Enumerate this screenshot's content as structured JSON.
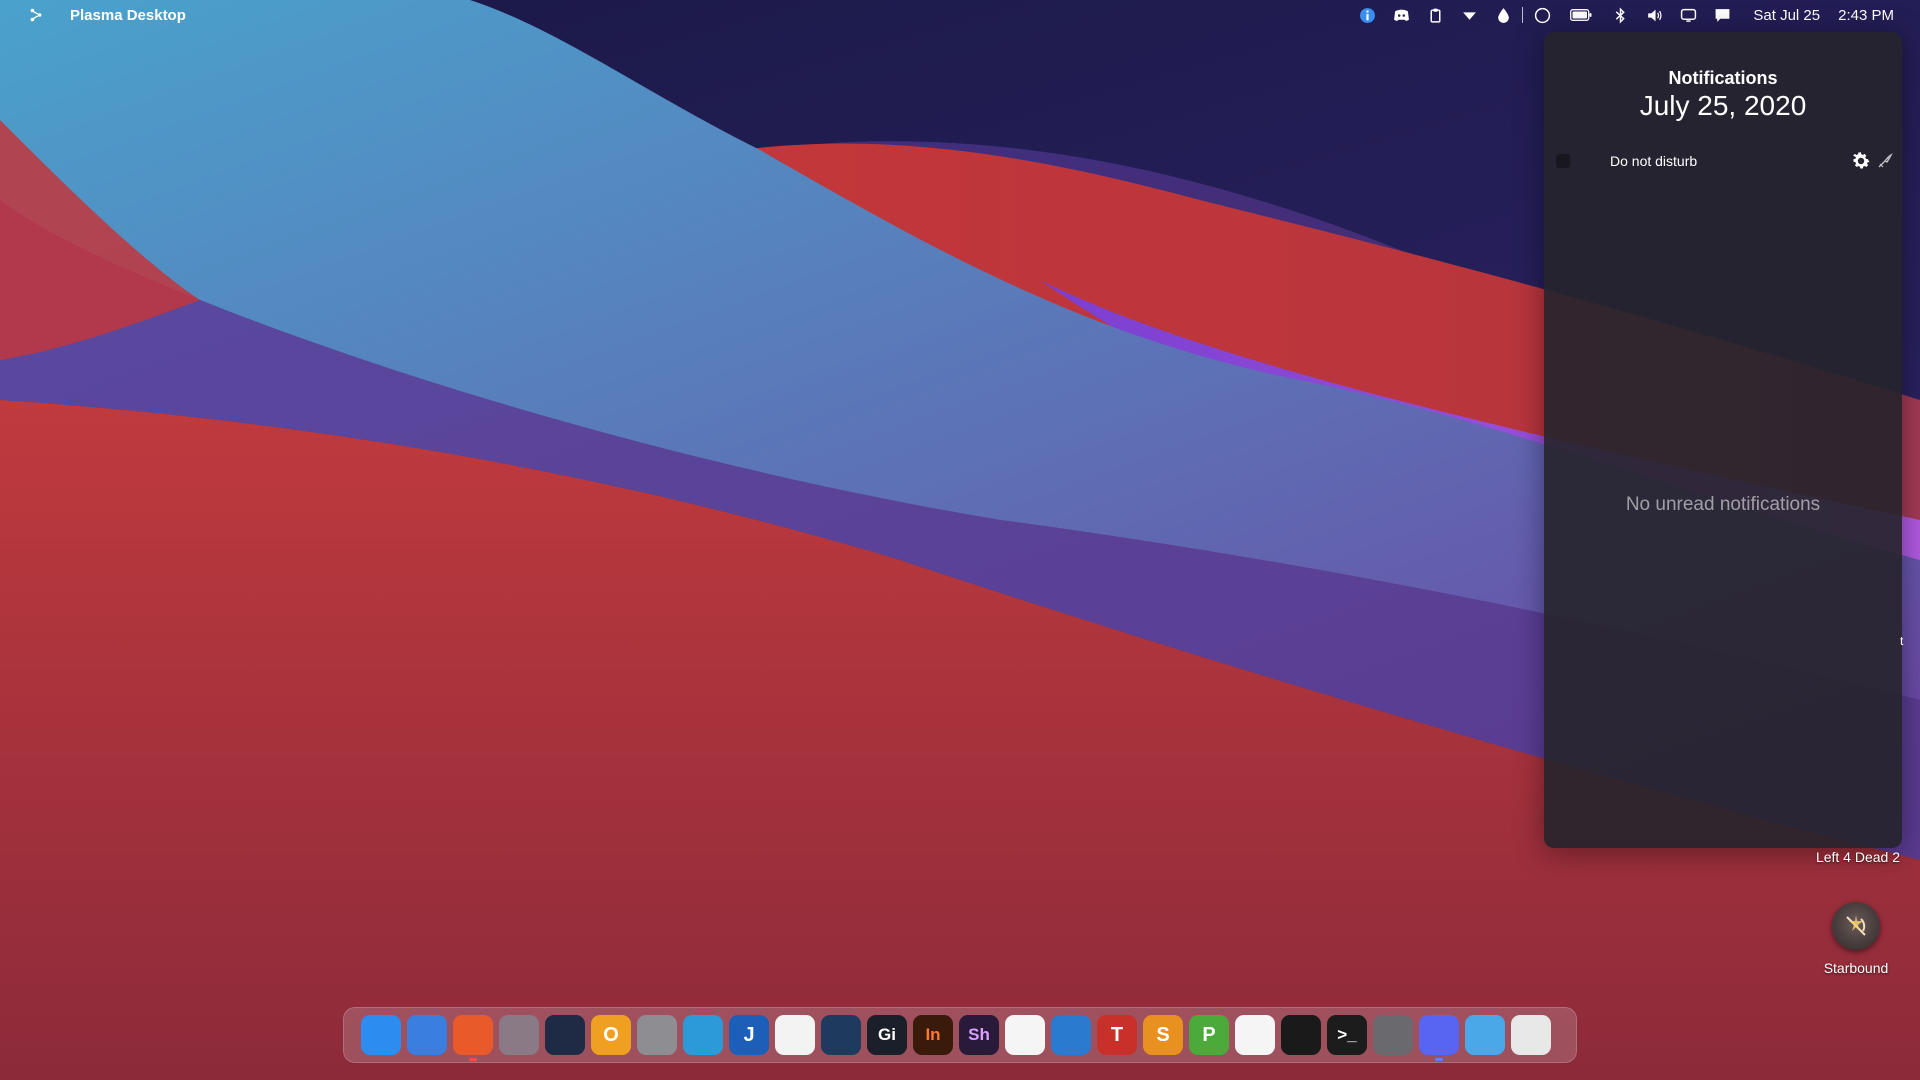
{
  "wallpaper": {
    "colors": {
      "navy": "#1f1b4d",
      "teal": "#5aa6c9",
      "violet": "#5a4ba0",
      "red": "#b8373a",
      "magenta": "#a64fd6"
    }
  },
  "menubar": {
    "app_title": "Plasma Desktop",
    "date": "Sat Jul 25",
    "time": "2:43 PM",
    "tray_icons": [
      "info-icon",
      "discord-tray-icon",
      "clipboard-icon",
      "dropdown-arrow-icon",
      "drop-icon",
      "circle-icon",
      "battery-icon",
      "bluetooth-icon",
      "volume-icon",
      "display-icon",
      "notifications-icon"
    ]
  },
  "notifications": {
    "title": "Notifications",
    "date": "July 25, 2020",
    "dnd_label": "Do not disturb",
    "empty_text": "No unread notifications"
  },
  "desktop": {
    "l4d2_label": "Left 4 Dead 2",
    "starbound_label": "Starbound",
    "edge_text": "t"
  },
  "dock": {
    "items": [
      {
        "name": "finder",
        "bg": "#2d8cf0",
        "text": "",
        "running": false
      },
      {
        "name": "launchpad",
        "bg": "#3a7fe0",
        "text": "",
        "running": false
      },
      {
        "name": "firefox",
        "bg": "#e85a2a",
        "text": "",
        "running": true,
        "dot": "#ff4a4a"
      },
      {
        "name": "macos-installer",
        "bg": "#8a7a86",
        "text": "",
        "running": false
      },
      {
        "name": "vscode",
        "bg": "#1f2a44",
        "text": "",
        "running": false
      },
      {
        "name": "o-app",
        "bg": "#f0a020",
        "text": "O",
        "running": false
      },
      {
        "name": "calculator",
        "bg": "#8e8e92",
        "text": "",
        "running": false
      },
      {
        "name": "xcode-tool",
        "bg": "#2c9ad8",
        "text": "",
        "running": false
      },
      {
        "name": "joplin",
        "bg": "#1b5fb8",
        "text": "J",
        "running": false
      },
      {
        "name": "photos",
        "bg": "#f3f3f3",
        "text": "",
        "running": false
      },
      {
        "name": "steam",
        "bg": "#1e3a5c",
        "text": "",
        "running": false
      },
      {
        "name": "gimp",
        "bg": "#1a1f2a",
        "text": "Gi",
        "running": false
      },
      {
        "name": "indesign",
        "bg": "#3a1a0a",
        "text": "In",
        "running": false
      },
      {
        "name": "shotcut",
        "bg": "#2a1a3a",
        "text": "Sh",
        "running": false
      },
      {
        "name": "music",
        "bg": "#f5f5f5",
        "text": "",
        "running": false
      },
      {
        "name": "quicktime",
        "bg": "#2a7ad0",
        "text": "",
        "running": false
      },
      {
        "name": "wps-writer",
        "bg": "#c8302a",
        "text": "T",
        "running": false
      },
      {
        "name": "wps-presentation",
        "bg": "#e89020",
        "text": "S",
        "running": false
      },
      {
        "name": "wps-spreadsheet",
        "bg": "#4caa3a",
        "text": "P",
        "running": false
      },
      {
        "name": "text-editor",
        "bg": "#f5f5f5",
        "text": "",
        "running": false
      },
      {
        "name": "activity-monitor",
        "bg": "#1a1a1a",
        "text": "",
        "running": false
      },
      {
        "name": "terminal",
        "bg": "#1c1c1c",
        "text": ">_",
        "running": false
      },
      {
        "name": "system-preferences",
        "bg": "#6a6a6e",
        "text": "",
        "running": false
      },
      {
        "name": "discord",
        "bg": "#5865f2",
        "text": "",
        "running": true,
        "dot": "#6a7aff"
      },
      {
        "name": "downloads-folder",
        "bg": "#4aa8e8",
        "text": "",
        "running": false
      },
      {
        "name": "trash",
        "bg": "#e8e8e8",
        "text": "",
        "running": false
      }
    ]
  }
}
